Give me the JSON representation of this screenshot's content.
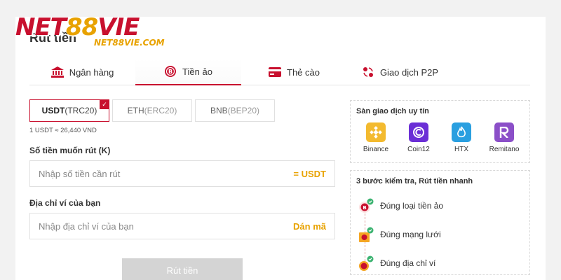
{
  "brand": {
    "name_part1": "NET",
    "name_part2": "88",
    "name_part3": "VIE",
    "sub": "NET88VIE.COM"
  },
  "page": {
    "title": "Rút tiền"
  },
  "tabs": [
    {
      "label": "Ngân hàng",
      "icon": "bank-icon",
      "active": false
    },
    {
      "label": "Tiền ảo",
      "icon": "crypto-coin-icon",
      "active": true
    },
    {
      "label": "Thẻ cào",
      "icon": "card-icon",
      "active": false
    },
    {
      "label": "Giao dịch P2P",
      "icon": "p2p-icon",
      "active": false
    }
  ],
  "coins": [
    {
      "symbol": "USDT",
      "network": "(TRC20)",
      "active": true
    },
    {
      "symbol": "ETH",
      "network": "(ERC20)",
      "active": false
    },
    {
      "symbol": "BNB",
      "network": "(BEP20)",
      "active": false
    }
  ],
  "rate": "1 USDT ≈ 26,440 VND",
  "amount": {
    "label": "Số tiền muốn rút (K)",
    "placeholder": "Nhập số tiền cần rút",
    "suffix": "= USDT",
    "value": ""
  },
  "wallet": {
    "label": "Địa chỉ ví của bạn",
    "placeholder": "Nhập địa chỉ ví của bạn",
    "paste_label": "Dán mã",
    "value": ""
  },
  "submit_label": "Rút tiền",
  "exchanges_box": {
    "title": "Sàn giao dịch uy tín",
    "items": [
      {
        "name": "Binance",
        "color": "#f3ba2f"
      },
      {
        "name": "Coin12",
        "color": "#6b2fd6"
      },
      {
        "name": "HTX",
        "color": "#2a9fe0"
      },
      {
        "name": "Remitano",
        "color": "#8b4fc8"
      }
    ]
  },
  "steps_box": {
    "title": "3 bước kiểm tra, Rút tiền nhanh",
    "steps": [
      {
        "label": "Đúng loại tiền ảo"
      },
      {
        "label": "Đúng mạng lưới"
      },
      {
        "label": "Đúng địa chỉ ví"
      }
    ]
  },
  "colors": {
    "accent": "#c8102e",
    "gold": "#e8a200",
    "check_green": "#3cb371"
  }
}
